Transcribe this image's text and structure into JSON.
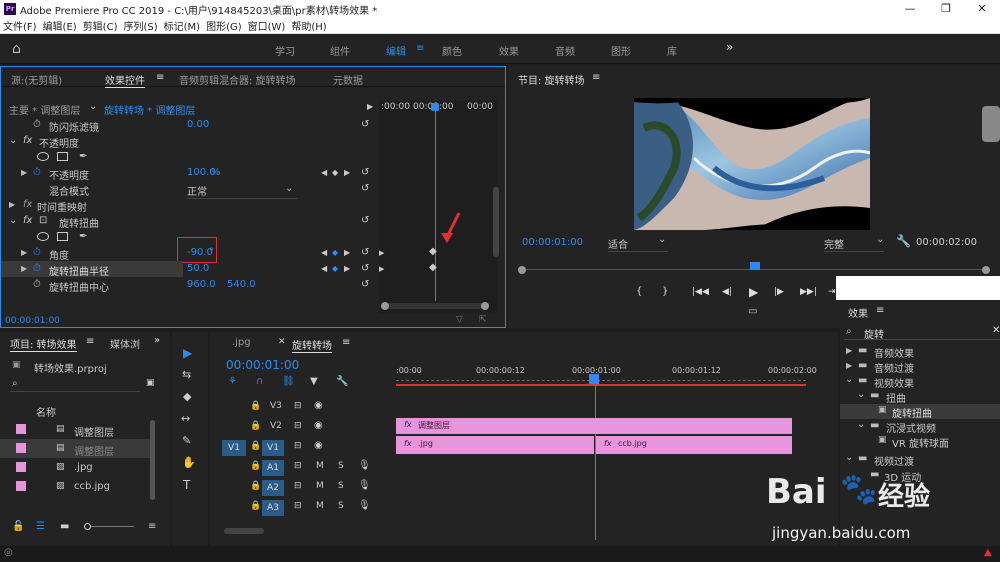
{
  "app": {
    "logo": "Pr",
    "title": "Adobe Premiere Pro CC 2019 - C:\\用户\\914845203\\桌面\\pr素材\\转场效果 *",
    "win_min": "—",
    "win_max": "❐",
    "win_close": "✕"
  },
  "menu": [
    "文件(F)",
    "编辑(E)",
    "剪辑(C)",
    "序列(S)",
    "标记(M)",
    "图形(G)",
    "窗口(W)",
    "帮助(H)"
  ],
  "workspaces": [
    "学习",
    "组件",
    "编辑",
    "颜色",
    "效果",
    "音频",
    "图形",
    "库"
  ],
  "workspace_menu_icon": "≡",
  "workspace_more": "»",
  "effect_controls": {
    "tabs": [
      "源:(无剪辑)",
      "效果控件",
      "音频剪辑混合器: 旋转转场",
      "元数据"
    ],
    "tab_menu_icon": "≡",
    "master": "主要 * 调整图层",
    "clip": "旋转转场 * 调整图层",
    "ruler": [
      ":00:00",
      "00:01:00",
      "00:00"
    ],
    "rows": {
      "flicker": "防闪烁滤镜",
      "flicker_val": "0.00",
      "opacity_fx": "fx",
      "opacity": "不透明度",
      "opacity_prop": "不透明度",
      "opacity_val": "100.0",
      "opacity_unit": "%",
      "blend": "混合模式",
      "blend_val": "正常",
      "time_remap": "时间重映射",
      "twirl_fx": "fx",
      "twirl": "旋转扭曲",
      "angle": "角度",
      "angle_val": "-90.0",
      "angle_unit": "°",
      "radius": "旋转扭曲半径",
      "radius_val": "50.0",
      "center": "旋转扭曲中心",
      "center_x": "960.0",
      "center_y": "540.0"
    },
    "timecode": "00:00:01:00"
  },
  "program": {
    "title": "节目: 旋转转场",
    "menu_icon": "≡",
    "timecode": "00:00:01:00",
    "fit": "适合",
    "quality": "完整",
    "duration": "00:00:02:00",
    "transport": [
      "{",
      "}",
      "|◀◀",
      "◀|",
      "▶",
      "|▶",
      "▶▶|",
      "⇥"
    ]
  },
  "project": {
    "tabs": [
      "项目: 转场效果",
      "媒体浏"
    ],
    "menu_icon": "≡",
    "more_icon": "»",
    "file": "转场效果.prproj",
    "column": "名称",
    "items": [
      {
        "name": "调整图层",
        "color": "#e694dc"
      },
      {
        "name": "调整图层",
        "color": "#e694dc"
      },
      {
        "name": ".jpg",
        "color": "#e694dc"
      },
      {
        "name": "ccb.jpg",
        "color": "#e694dc"
      }
    ]
  },
  "timeline": {
    "tab_jpg": ".jpg",
    "tab_close": "✕",
    "tab_active": "旋转转场",
    "menu_icon": "≡",
    "timecode": "00:00:01:00",
    "ruler": [
      ":00:00",
      "00:00:00:12",
      "00:00:01:00",
      "00:00:01:12",
      "00:00:02:00"
    ],
    "video_tracks": [
      "V3",
      "V2",
      "V1"
    ],
    "audio_tracks": [
      "A1",
      "A2",
      "A3"
    ],
    "source_v1": "V1",
    "clip_adjust": "调整图层",
    "clip_jpg": ".jpg",
    "clip_ccb": "ccb.jpg",
    "fx": "fx",
    "m": "M",
    "s": "S"
  },
  "effects": {
    "title": "效果",
    "menu_icon": "≡",
    "search": "旋转",
    "tree": [
      {
        "label": "音频效果",
        "level": 0
      },
      {
        "label": "音频过渡",
        "level": 0
      },
      {
        "label": "视频效果",
        "level": 0
      },
      {
        "label": "扭曲",
        "level": 1
      },
      {
        "label": "旋转扭曲",
        "level": 2
      },
      {
        "label": "沉浸式视频",
        "level": 1
      },
      {
        "label": "VR 旋转球面",
        "level": 2
      },
      {
        "label": "视频过渡",
        "level": 0
      },
      {
        "label": "3D 运动",
        "level": 1
      }
    ]
  },
  "tools": [
    "▶",
    "⇆",
    "◆",
    "↔",
    "✎",
    "✋",
    "T"
  ],
  "watermark": {
    "brand": "Bai",
    "suffix": "经验",
    "url": "jingyan.baidu.com"
  },
  "colors": {
    "accent": "#2d8ceb",
    "clip": "#e694dc",
    "warning": "#e03030"
  }
}
